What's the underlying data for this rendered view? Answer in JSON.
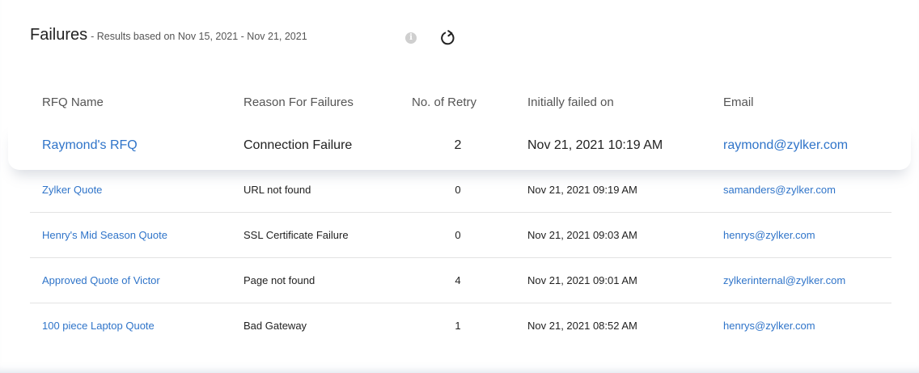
{
  "header": {
    "title": "Failures",
    "subtitle": "- Results based on Nov 15, 2021 - Nov 21, 2021",
    "info_glyph": "i",
    "info_icon": "info-icon",
    "refresh_icon": "refresh-icon"
  },
  "table": {
    "columns": [
      "RFQ Name",
      "Reason For Failures",
      "No. of Retry",
      "Initially failed on",
      "Email"
    ],
    "rows": [
      {
        "name": "Raymond's RFQ",
        "reason": "Connection Failure",
        "retry": "2",
        "failed_on": "Nov 21, 2021 10:19 AM",
        "email": "raymond@zylker.com"
      },
      {
        "name": "Zylker Quote",
        "reason": "URL not found",
        "retry": "0",
        "failed_on": "Nov 21, 2021 09:19 AM",
        "email": "samanders@zylker.com"
      },
      {
        "name": "Henry's Mid Season Quote",
        "reason": "SSL Certificate Failure",
        "retry": "0",
        "failed_on": "Nov 21, 2021 09:03 AM",
        "email": "henrys@zylker.com"
      },
      {
        "name": "Approved Quote of Victor",
        "reason": "Page not found",
        "retry": "4",
        "failed_on": "Nov 21, 2021 09:01 AM",
        "email": "zylkerinternal@zylker.com"
      },
      {
        "name": "100 piece Laptop Quote",
        "reason": "Bad Gateway",
        "retry": "1",
        "failed_on": "Nov 21, 2021 08:52 AM",
        "email": "henrys@zylker.com"
      }
    ]
  },
  "colors": {
    "link": "#2f74c9",
    "text": "#222222",
    "header_text": "#555555",
    "divider": "#e3e3e3",
    "background": "#e9eef6"
  }
}
